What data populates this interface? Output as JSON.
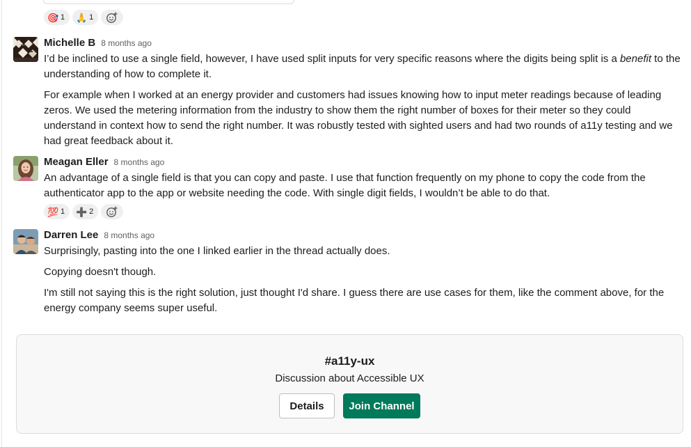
{
  "top_reactions": [
    {
      "icon": "direct-hit-icon",
      "glyph": "🎯",
      "count": "1"
    },
    {
      "icon": "folded-hands-icon",
      "glyph": "🙏",
      "count": "1"
    }
  ],
  "messages": [
    {
      "author": "Michelle B",
      "time": "8 months ago",
      "paragraphs": [
        "I’d be inclined to use a single field, however, I have used split inputs for very specific reasons where the digits being split is a ",
        "benefit",
        " to the understanding of how to complete it.",
        "For example when I worked at an energy provider and customers had issues knowing how to input meter readings because of leading zeros. We used the metering information from the industry to show them the right number of boxes for their meter so they could understand in context how to send the right number. It was robustly tested with sighted users and had two rounds of a11y testing and we had great feedback about it."
      ]
    },
    {
      "author": "Meagan Eller",
      "time": "8 months ago",
      "paragraphs": [
        "An advantage of a single field is that you can copy and paste. I use that function frequently on my phone to copy the code from the authenticator app to the app or website needing the code. With single digit fields, I wouldn’t be able to do that."
      ],
      "reactions": [
        {
          "icon": "hundred-points-icon",
          "glyph": "💯",
          "count": "1"
        },
        {
          "icon": "heavy-plus-icon",
          "glyph": "➕",
          "count": "2"
        }
      ]
    },
    {
      "author": "Darren Lee",
      "time": "8 months ago",
      "paragraphs": [
        "Surprisingly, pasting into the one I linked earlier in the thread actually does.",
        "Copying doesn't though.",
        "I'm still not saying this is the right solution, just thought I'd share. I guess there are use cases for them, like the comment above, for the energy company seems super useful."
      ]
    }
  ],
  "channel": {
    "name": "#a11y-ux",
    "description": "Discussion about Accessible UX",
    "details_label": "Details",
    "join_label": "Join Channel"
  },
  "colors": {
    "join_button": "#007a5a",
    "reaction_bg": "#efefef"
  }
}
